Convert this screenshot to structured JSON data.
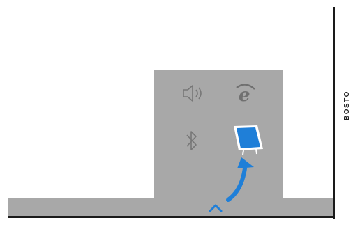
{
  "frame": {
    "side_label": "BOSTO"
  },
  "tray": {
    "icons": [
      {
        "name": "speaker-icon"
      },
      {
        "name": "internet-explorer-icon"
      },
      {
        "name": "bluetooth-icon"
      },
      {
        "name": "pen-tablet-device-icon"
      }
    ],
    "overflow_chevron": "chevron-up-icon"
  },
  "colors": {
    "taskbar": "#a8a8a8",
    "frame": "#1a1a1a",
    "icon_gray": "#777777",
    "accent_blue": "#1f7fd8"
  }
}
